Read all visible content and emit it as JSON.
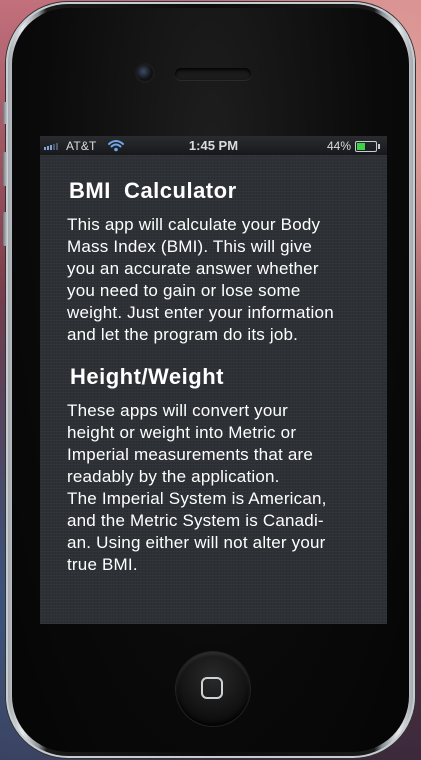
{
  "status_bar": {
    "carrier": "AT&T",
    "time": "1:45 PM",
    "battery_percent": "44%",
    "battery_level": 0.44,
    "signal_icon": "signal-bars-icon",
    "wifi_icon": "wifi-icon",
    "battery_icon": "battery-icon",
    "signal_color": "#7fa4d6",
    "battery_color": "#3fd14a"
  },
  "sections": [
    {
      "title": "BMI  Calculator",
      "body": "This app will calculate your Body\nMass Index (BMI). This will give\nyou an accurate answer whether\nyou need to gain or lose some\nweight. Just enter your information\nand let the program do its job."
    },
    {
      "title": "Height/Weight",
      "body": "These apps will convert your\nheight or weight into Metric or\nImperial measurements that are\nreadably by the application.\nThe Imperial System is American,\nand the Metric System is Canadi-\nan. Using either will not alter your\ntrue BMI."
    }
  ],
  "device": {
    "home_button_icon": "home-button-icon",
    "camera_icon": "front-camera-icon",
    "screen_background": "#2d3035"
  }
}
